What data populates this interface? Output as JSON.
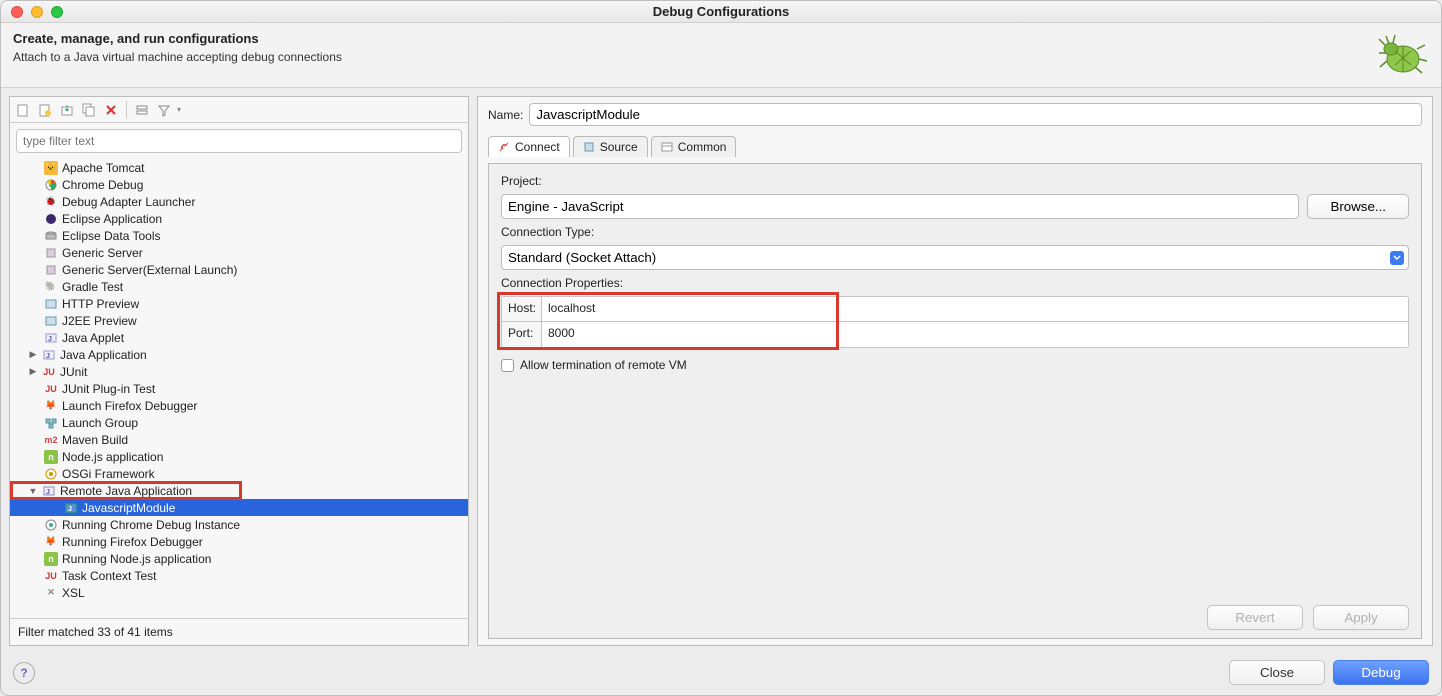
{
  "window": {
    "title": "Debug Configurations"
  },
  "header": {
    "title": "Create, manage, and run configurations",
    "subtitle": "Attach to a Java virtual machine accepting debug connections"
  },
  "left": {
    "filter_placeholder": "type filter text",
    "items": {
      "apache_tomcat": "Apache Tomcat",
      "chrome_debug": "Chrome Debug",
      "debug_adapter": "Debug Adapter Launcher",
      "eclipse_app": "Eclipse Application",
      "eclipse_data": "Eclipse Data Tools",
      "generic_server": "Generic Server",
      "generic_server_ext": "Generic Server(External Launch)",
      "gradle_test": "Gradle Test",
      "http_preview": "HTTP Preview",
      "j2ee_preview": "J2EE Preview",
      "java_applet": "Java Applet",
      "java_app": "Java Application",
      "junit": "JUnit",
      "junit_plugin": "JUnit Plug-in Test",
      "firefox_dbg": "Launch Firefox Debugger",
      "launch_group": "Launch Group",
      "maven_build": "Maven Build",
      "node_app": "Node.js application",
      "osgi": "OSGi Framework",
      "remote_java": "Remote Java Application",
      "javascript_module": "JavascriptModule",
      "running_chrome": "Running Chrome Debug Instance",
      "running_firefox": "Running Firefox Debugger",
      "running_node": "Running Node.js application",
      "task_ctx": "Task Context Test",
      "xsl": "XSL"
    },
    "footer": "Filter matched 33 of 41 items"
  },
  "right": {
    "name_label": "Name:",
    "name_value": "JavascriptModule",
    "tabs": {
      "connect": "Connect",
      "source": "Source",
      "common": "Common"
    },
    "project_label": "Project:",
    "project_value": "Engine - JavaScript",
    "browse": "Browse...",
    "conn_type_label": "Connection Type:",
    "conn_type_value": "Standard (Socket Attach)",
    "conn_props_label": "Connection Properties:",
    "host_label": "Host:",
    "host_value": "localhost",
    "port_label": "Port:",
    "port_value": "8000",
    "allow_term": "Allow termination of remote VM",
    "revert": "Revert",
    "apply": "Apply"
  },
  "bottom": {
    "close": "Close",
    "debug": "Debug"
  }
}
